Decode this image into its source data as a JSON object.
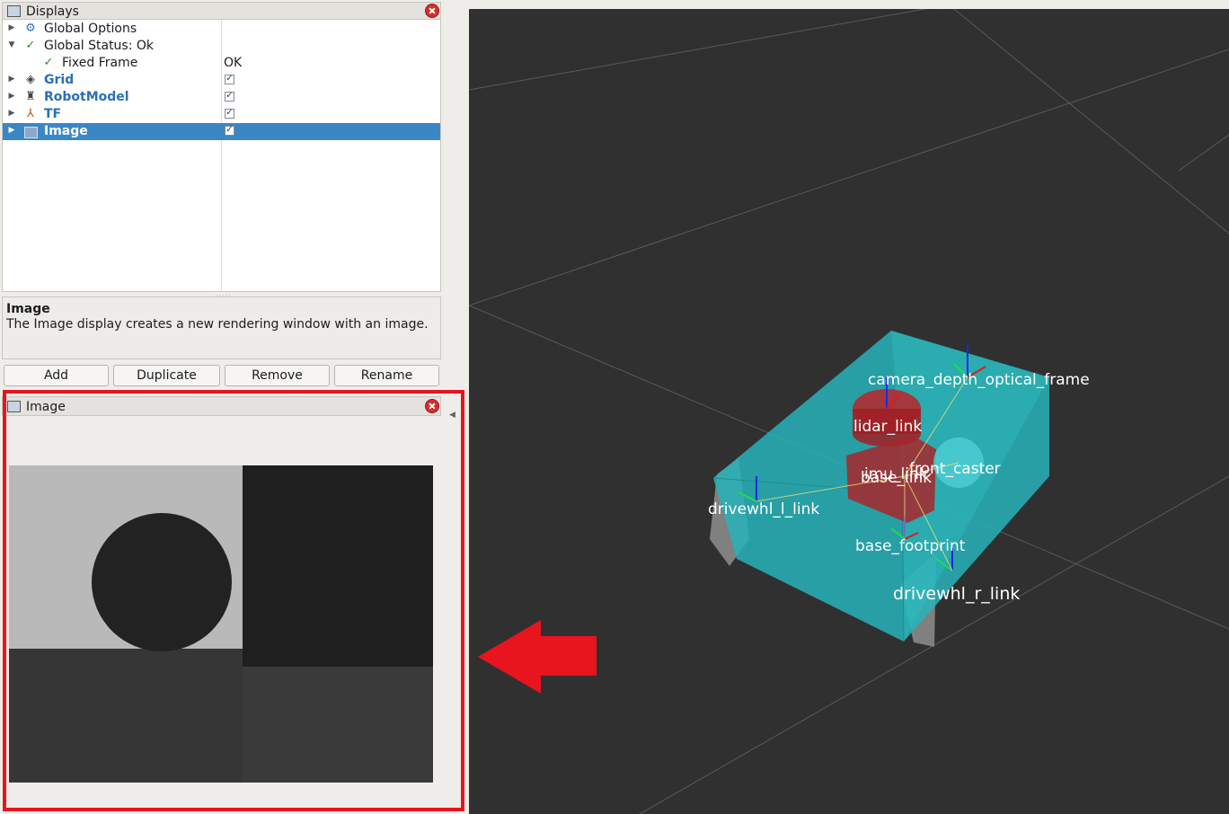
{
  "displays": {
    "title": "Displays",
    "rows": [
      {
        "label": "Global Options",
        "value": "",
        "expanded": false
      },
      {
        "label": "Global Status: Ok",
        "value": "",
        "expanded": true
      },
      {
        "label": "Fixed Frame",
        "value": "OK"
      },
      {
        "label": "Grid",
        "checked": true
      },
      {
        "label": "RobotModel",
        "checked": true
      },
      {
        "label": "TF",
        "checked": true
      },
      {
        "label": "Image",
        "checked": true,
        "selected": true
      }
    ]
  },
  "description": {
    "title": "Image",
    "text": "The Image display creates a new rendering window with an image."
  },
  "buttons": {
    "add": "Add",
    "duplicate": "Duplicate",
    "remove": "Remove",
    "rename": "Rename"
  },
  "image_panel": {
    "title": "Image"
  },
  "viewport": {
    "labels": {
      "camera": "camera_depth_optical_frame",
      "lidar": "lidar_link",
      "imu": "imu_link",
      "front_caster": "front_caster",
      "base_link": "base_link",
      "drivewhl_l": "drivewhl_l_link",
      "base_footprint": "base_footprint",
      "drivewhl_r": "drivewhl_r_link"
    }
  },
  "colors": {
    "selection": "#3a87c6",
    "highlight_frame": "#e8141e",
    "robot_body": "#27b3b8",
    "robot_parts": "#b8242a"
  }
}
